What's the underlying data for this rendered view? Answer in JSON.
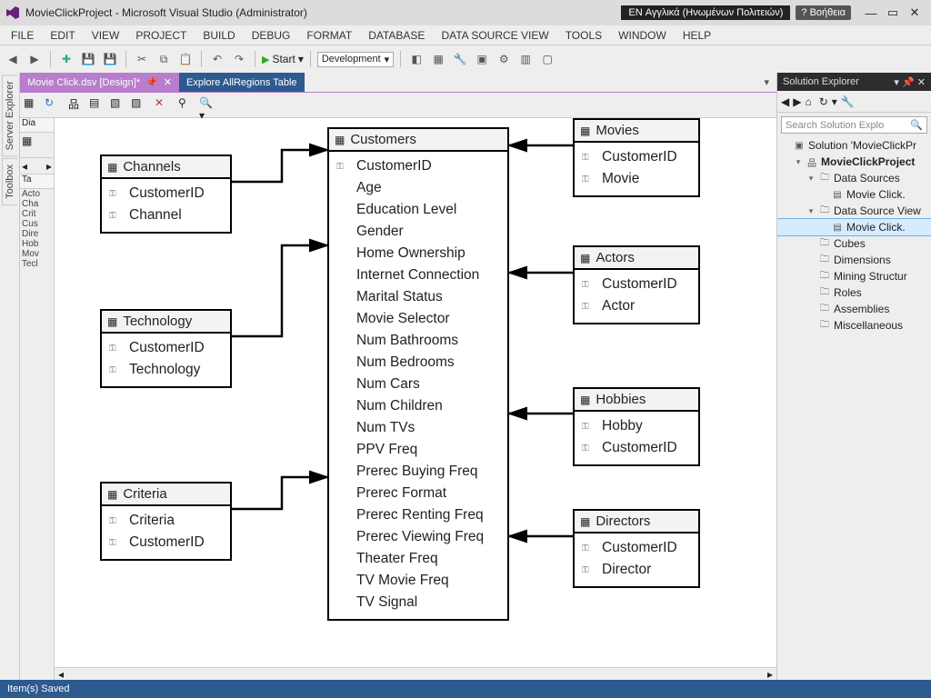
{
  "titlebar": {
    "app": "MovieClickProject - Microsoft Visual Studio (Administrator)",
    "lang": "EN Αγγλικά (Ηνωμένων Πολιτειών)",
    "help": "? Βοήθεια"
  },
  "menu": [
    "FILE",
    "EDIT",
    "VIEW",
    "PROJECT",
    "BUILD",
    "DEBUG",
    "FORMAT",
    "DATABASE",
    "DATA SOURCE VIEW",
    "TOOLS",
    "WINDOW",
    "HELP"
  ],
  "toolbar": {
    "start": "Start",
    "config": "Development"
  },
  "tabs": {
    "active": "Movie Click.dsv [Design]*",
    "inactive": "Explore AllRegions Table"
  },
  "left_dock": [
    "Server Explorer",
    "Toolbox"
  ],
  "side_panel": {
    "header1": "Dia",
    "header2": "Ta",
    "items": [
      "Acto",
      "Cha",
      "Crit",
      "Cus",
      "Dire",
      "Hob",
      "Mov",
      "Tecl"
    ]
  },
  "tables": {
    "channels": {
      "title": "Channels",
      "cols": [
        "CustomerID",
        "Channel"
      ]
    },
    "technology": {
      "title": "Technology",
      "cols": [
        "CustomerID",
        "Technology"
      ]
    },
    "criteria": {
      "title": "Criteria",
      "cols": [
        "Criteria",
        "CustomerID"
      ]
    },
    "customers": {
      "title": "Customers",
      "cols": [
        "CustomerID",
        "Age",
        "Education Level",
        "Gender",
        "Home Ownership",
        "Internet Connection",
        "Marital Status",
        "Movie Selector",
        "Num Bathrooms",
        "Num Bedrooms",
        "Num Cars",
        "Num Children",
        "Num TVs",
        "PPV Freq",
        "Prerec Buying Freq",
        "Prerec Format",
        "Prerec Renting Freq",
        "Prerec Viewing Freq",
        "Theater Freq",
        "TV Movie Freq",
        "TV Signal"
      ]
    },
    "movies": {
      "title": "Movies",
      "cols": [
        "CustomerID",
        "Movie"
      ]
    },
    "actors": {
      "title": "Actors",
      "cols": [
        "CustomerID",
        "Actor"
      ]
    },
    "hobbies": {
      "title": "Hobbies",
      "cols": [
        "Hobby",
        "CustomerID"
      ]
    },
    "directors": {
      "title": "Directors",
      "cols": [
        "CustomerID",
        "Director"
      ]
    }
  },
  "solution": {
    "title": "Solution Explorer",
    "search_placeholder": "Search Solution Explo",
    "nodes": [
      {
        "depth": 0,
        "exp": "",
        "icon": "sol",
        "label": "Solution 'MovieClickPr"
      },
      {
        "depth": 1,
        "exp": "▾",
        "icon": "proj",
        "label": "MovieClickProject",
        "bold": true
      },
      {
        "depth": 2,
        "exp": "▾",
        "icon": "fld",
        "label": "Data Sources"
      },
      {
        "depth": 3,
        "exp": "",
        "icon": "ds",
        "label": "Movie Click."
      },
      {
        "depth": 2,
        "exp": "▾",
        "icon": "fld",
        "label": "Data Source View"
      },
      {
        "depth": 3,
        "exp": "",
        "icon": "dsv",
        "label": "Movie Click.",
        "sel": true
      },
      {
        "depth": 2,
        "exp": "",
        "icon": "fld",
        "label": "Cubes"
      },
      {
        "depth": 2,
        "exp": "",
        "icon": "fld",
        "label": "Dimensions"
      },
      {
        "depth": 2,
        "exp": "",
        "icon": "fld",
        "label": "Mining Structur"
      },
      {
        "depth": 2,
        "exp": "",
        "icon": "fld",
        "label": "Roles"
      },
      {
        "depth": 2,
        "exp": "",
        "icon": "fld",
        "label": "Assemblies"
      },
      {
        "depth": 2,
        "exp": "",
        "icon": "fld",
        "label": "Miscellaneous"
      }
    ]
  },
  "status": "Item(s) Saved"
}
